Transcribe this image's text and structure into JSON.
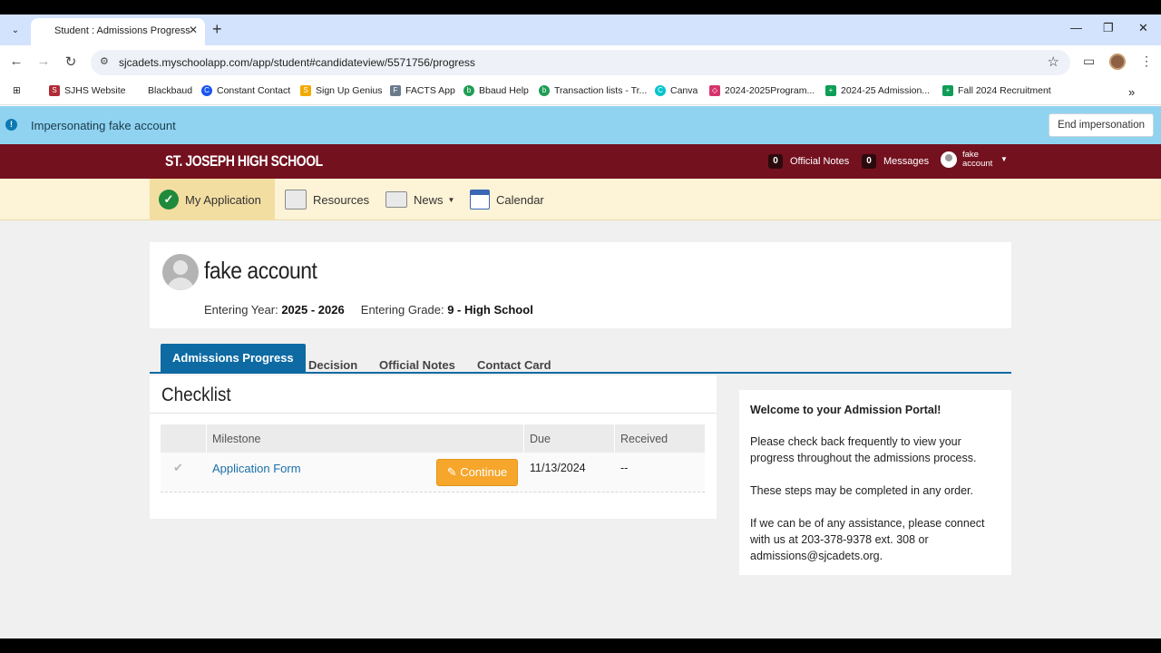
{
  "browser": {
    "tab_title": "Student : Admissions Progress",
    "url": "sjcadets.myschoolapp.com/app/student#candidateview/5571756/progress",
    "bookmarks": [
      {
        "label": "SJHS Website",
        "color": "#b02a37"
      },
      {
        "label": "Blackbaud",
        "color": "#ffffff"
      },
      {
        "label": "Constant Contact",
        "color": "#1856ed"
      },
      {
        "label": "Sign Up Genius",
        "color": "#f2a900"
      },
      {
        "label": "FACTS App",
        "color": "#6b7b8c"
      },
      {
        "label": "Bbaud Help",
        "color": "#1f9d55"
      },
      {
        "label": "Transaction lists - Tr...",
        "color": "#1f9d55"
      },
      {
        "label": "Canva",
        "color": "#00c4cc"
      },
      {
        "label": "2024-2025Program...",
        "color": "#d6336c"
      },
      {
        "label": "2024-25 Admission...",
        "color": "#0f9d58"
      },
      {
        "label": "Fall 2024 Recruitment",
        "color": "#0f9d58"
      }
    ]
  },
  "impersonation": {
    "text": "Impersonating fake account",
    "end_label": "End impersonation"
  },
  "header": {
    "school_name": "ST. JOSEPH HIGH SCHOOL",
    "notes_count": "0",
    "notes_label": "Official Notes",
    "messages_count": "0",
    "messages_label": "Messages",
    "user_line1": "fake",
    "user_line2": "account"
  },
  "nav": {
    "my_application": "My Application",
    "resources": "Resources",
    "news": "News",
    "calendar": "Calendar"
  },
  "profile": {
    "name": "fake account",
    "entering_year_label": "Entering Year:",
    "entering_year": "2025 - 2026",
    "entering_grade_label": "Entering Grade:",
    "entering_grade": "9 - High School"
  },
  "tabs": {
    "admissions_progress": "Admissions Progress",
    "decision": "Decision",
    "official_notes": "Official Notes",
    "contact_card": "Contact Card"
  },
  "checklist": {
    "title": "Checklist",
    "col_milestone": "Milestone",
    "col_due": "Due",
    "col_received": "Received",
    "rows": [
      {
        "milestone": "Application Form",
        "button": "Continue",
        "due": "11/13/2024",
        "received": "--"
      }
    ]
  },
  "welcome": {
    "title": "Welcome to your Admission Portal!",
    "p1": "Please check back frequently to view your progress throughout the admissions process.",
    "p2": "These steps may be completed in any order.",
    "p3": "If we can be of any assistance, please connect with us at 203-378-9378 ext. 308 or admissions@sjcadets.org."
  }
}
